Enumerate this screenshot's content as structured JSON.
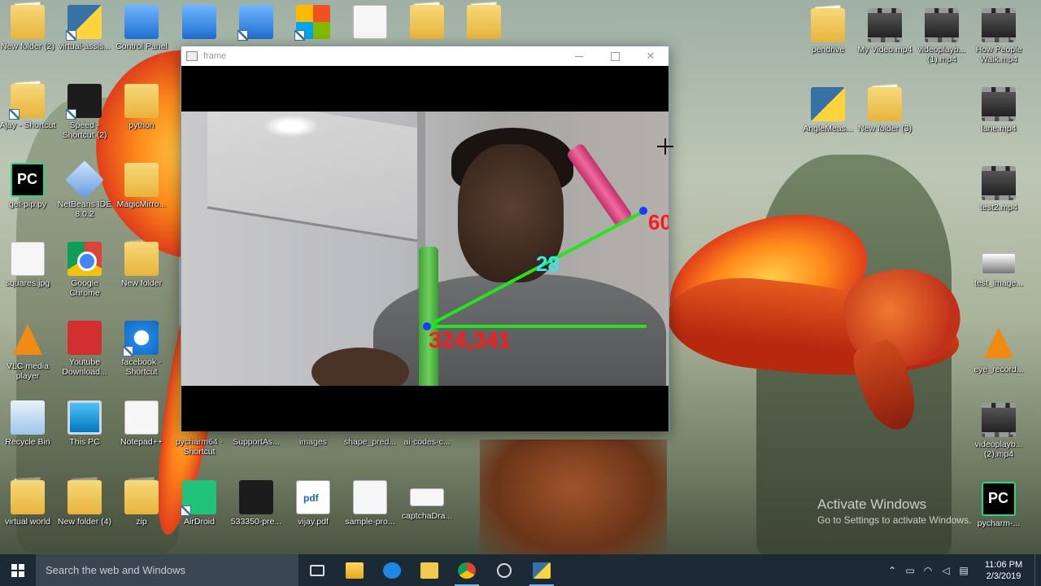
{
  "desktop": {
    "icons_left": [
      {
        "label": "New folder (2)",
        "icon": "folder-icon"
      },
      {
        "label": "virtual-assis...",
        "icon": "python-file-icon"
      },
      {
        "label": "Control Panel",
        "icon": "control-panel-icon"
      },
      {
        "label": "Ajay - Shortcut",
        "icon": "folder-shortcut-icon"
      },
      {
        "label": "Speed - Shortcut (2)",
        "icon": "speed-game-icon"
      },
      {
        "label": "python",
        "icon": "folder-icon"
      },
      {
        "label": "get-pip.py",
        "icon": "pycharm-file-icon"
      },
      {
        "label": "NetBeans IDE 8.0.2",
        "icon": "netbeans-icon"
      },
      {
        "label": "MagicMirro...",
        "icon": "folder-icon"
      },
      {
        "label": "squares.jpg",
        "icon": "image-file-icon"
      },
      {
        "label": "Google Chrome",
        "icon": "chrome-icon"
      },
      {
        "label": "New folder",
        "icon": "folder-icon"
      },
      {
        "label": "VLC media player",
        "icon": "vlc-icon"
      },
      {
        "label": "Youtube Download...",
        "icon": "youtube-downloader-icon"
      },
      {
        "label": "facebook - Shortcut",
        "icon": "internet-explorer-icon"
      },
      {
        "label": "Recycle Bin",
        "icon": "recycle-bin-icon"
      },
      {
        "label": "This PC",
        "icon": "this-pc-icon"
      },
      {
        "label": "Notepad++",
        "icon": "notepad-plus-plus-icon"
      },
      {
        "label": "pycharm64 - Shortcut",
        "icon": "pycharm-icon"
      },
      {
        "label": "SupportAs...",
        "icon": "support-icon"
      },
      {
        "label": "images",
        "icon": "folder-icon"
      },
      {
        "label": "shape_pred...",
        "icon": "file-icon"
      },
      {
        "label": "ai-codes-c...",
        "icon": "file-icon"
      },
      {
        "label": "virtual world",
        "icon": "folder-icon"
      },
      {
        "label": "New folder (4)",
        "icon": "folder-icon"
      },
      {
        "label": "zip",
        "icon": "folder-icon"
      },
      {
        "label": "AirDroid",
        "icon": "airdroid-icon"
      },
      {
        "label": "533350-pre...",
        "icon": "image-file-icon"
      },
      {
        "label": "vijay.pdf",
        "icon": "pdf-icon"
      },
      {
        "label": "sample-pro...",
        "icon": "document-icon"
      },
      {
        "label": "captchaDra...",
        "icon": "image-file-icon"
      }
    ],
    "icons_right": [
      {
        "label": "pendrive",
        "icon": "folder-icon"
      },
      {
        "label": "My Video.mp4",
        "icon": "video-file-icon"
      },
      {
        "label": "videoplayb... (1).mp4",
        "icon": "video-file-icon"
      },
      {
        "label": "How People Walk.mp4",
        "icon": "video-file-icon"
      },
      {
        "label": "AngleMeas...",
        "icon": "python-file-icon"
      },
      {
        "label": "New folder (3)",
        "icon": "folder-icon"
      },
      {
        "label": "lane.mp4",
        "icon": "video-file-icon"
      },
      {
        "label": "test2.mp4",
        "icon": "video-file-icon"
      },
      {
        "label": "test_image...",
        "icon": "image-file-icon"
      },
      {
        "label": "eye_record...",
        "icon": "vlc-icon"
      },
      {
        "label": "videoplayb... (2).mp4",
        "icon": "video-file-icon"
      },
      {
        "label": "pycharm-...",
        "icon": "pycharm-icon"
      }
    ]
  },
  "window": {
    "title": "frame",
    "overlay": {
      "angle_value": "28",
      "point_label": "324,341",
      "top_right_label": "60",
      "line_color": "#22e61a",
      "angle_color": "#34e5f5",
      "label_color": "#ff1a1a"
    }
  },
  "watermark": {
    "line1": "Activate Windows",
    "line2": "Go to Settings to activate Windows."
  },
  "taskbar": {
    "search_placeholder": "Search the web and Windows",
    "apps": [
      {
        "name": "task-view",
        "icon": "task-view-icon"
      },
      {
        "name": "file-explorer",
        "icon": "file-explorer-icon"
      },
      {
        "name": "edge",
        "icon": "edge-icon"
      },
      {
        "name": "store",
        "icon": "store-icon"
      },
      {
        "name": "chrome",
        "icon": "chrome-icon"
      },
      {
        "name": "obs",
        "icon": "recorder-icon"
      },
      {
        "name": "python",
        "icon": "python-icon"
      }
    ],
    "clock_time": "11:06 PM",
    "clock_date": "2/3/2019"
  }
}
